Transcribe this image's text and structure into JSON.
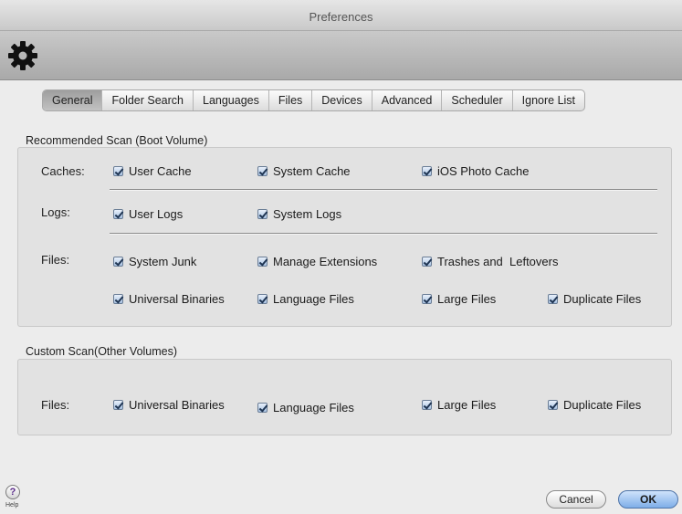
{
  "window": {
    "title": "Preferences"
  },
  "toolbar": {
    "icon": "gear-icon"
  },
  "tabs": [
    {
      "label": "General",
      "active": true
    },
    {
      "label": "Folder Search",
      "active": false
    },
    {
      "label": "Languages",
      "active": false
    },
    {
      "label": "Files",
      "active": false
    },
    {
      "label": "Devices",
      "active": false
    },
    {
      "label": "Advanced",
      "active": false
    },
    {
      "label": "Scheduler",
      "active": false
    },
    {
      "label": "Ignore List",
      "active": false
    }
  ],
  "recommended": {
    "title": "Recommended Scan (Boot Volume)",
    "caches": {
      "label": "Caches:",
      "items": [
        "User Cache",
        "System Cache",
        "iOS Photo Cache"
      ]
    },
    "logs": {
      "label": "Logs:",
      "items": [
        "User Logs",
        "System Logs"
      ]
    },
    "files": {
      "label": "Files:",
      "items": [
        "System Junk",
        "Manage Extensions",
        "Trashes and  Leftovers",
        "Universal Binaries",
        "Language Files",
        "Large Files",
        "Duplicate Files"
      ]
    }
  },
  "custom": {
    "title": "Custom Scan(Other Volumes)",
    "files": {
      "label": "Files:",
      "items": [
        "Universal Binaries",
        "Language Files",
        "Large Files",
        "Duplicate Files"
      ]
    }
  },
  "footer": {
    "help_glyph": "?",
    "help_label": "Help",
    "cancel": "Cancel",
    "ok": "OK"
  },
  "colors": {
    "accent": "#7eaee8",
    "checkbox": "#a9c3e3"
  }
}
